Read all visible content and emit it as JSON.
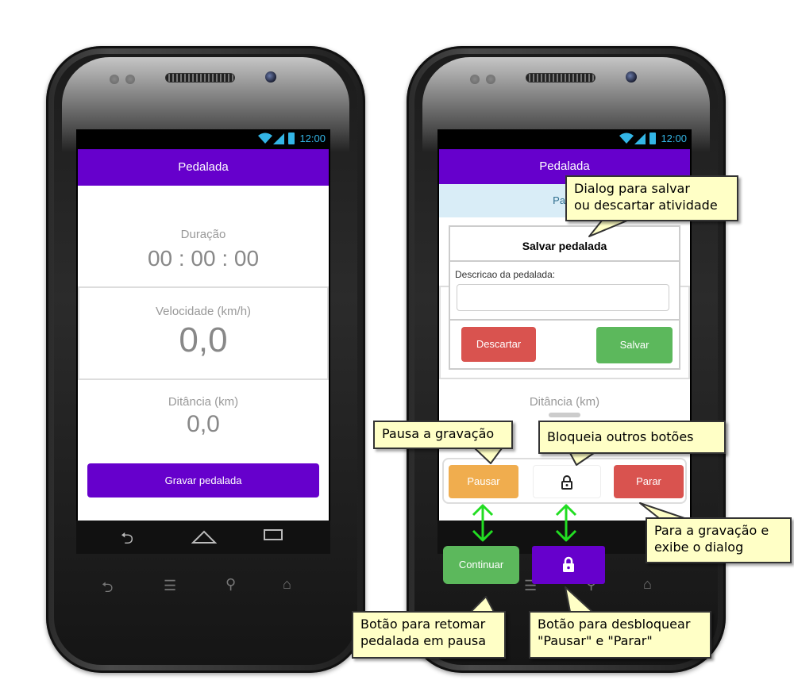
{
  "status_bar": {
    "time": "12:00"
  },
  "left_phone": {
    "app_title": "Pedalada",
    "duration_label": "Duração",
    "duration_value": "00 : 00 : 00",
    "speed_label": "Velocidade (km/h)",
    "speed_value": "0,0",
    "distance_label": "Ditância (km)",
    "distance_value": "0,0",
    "record_button": "Gravar pedalada"
  },
  "right_phone": {
    "app_title": "Pedalada",
    "banner_text": "Paus",
    "dialog": {
      "title": "Salvar pedalada",
      "field_label": "Descricao da pedalada:",
      "field_value": "",
      "discard_button": "Descartar",
      "save_button": "Salvar"
    },
    "distance_label": "Ditância (km)",
    "pause_button": "Pausar",
    "stop_button": "Parar",
    "continue_button": "Continuar"
  },
  "callouts": {
    "dialog": "Dialog para salvar\nou descartar atividade",
    "pause": "Pausa a gravação",
    "lock": "Bloqueia outros botões",
    "stop": "Para a gravação e\nexibe o dialog",
    "continue": "Botão para retomar\npedalada em pausa",
    "unlock": "Botão para desbloquear\n\"Pausar\" e \"Parar\""
  },
  "colors": {
    "primary": "#6600cc",
    "pause": "#f0ad4e",
    "danger": "#d9534f",
    "success": "#5cb85c",
    "callout_bg": "#ffffc6",
    "arrow": "#22dd22"
  },
  "icons": [
    "wifi-icon",
    "signal-icon",
    "battery-icon",
    "back-icon",
    "home-icon",
    "recents-icon",
    "menu-icon",
    "search-icon",
    "lock-icon"
  ]
}
